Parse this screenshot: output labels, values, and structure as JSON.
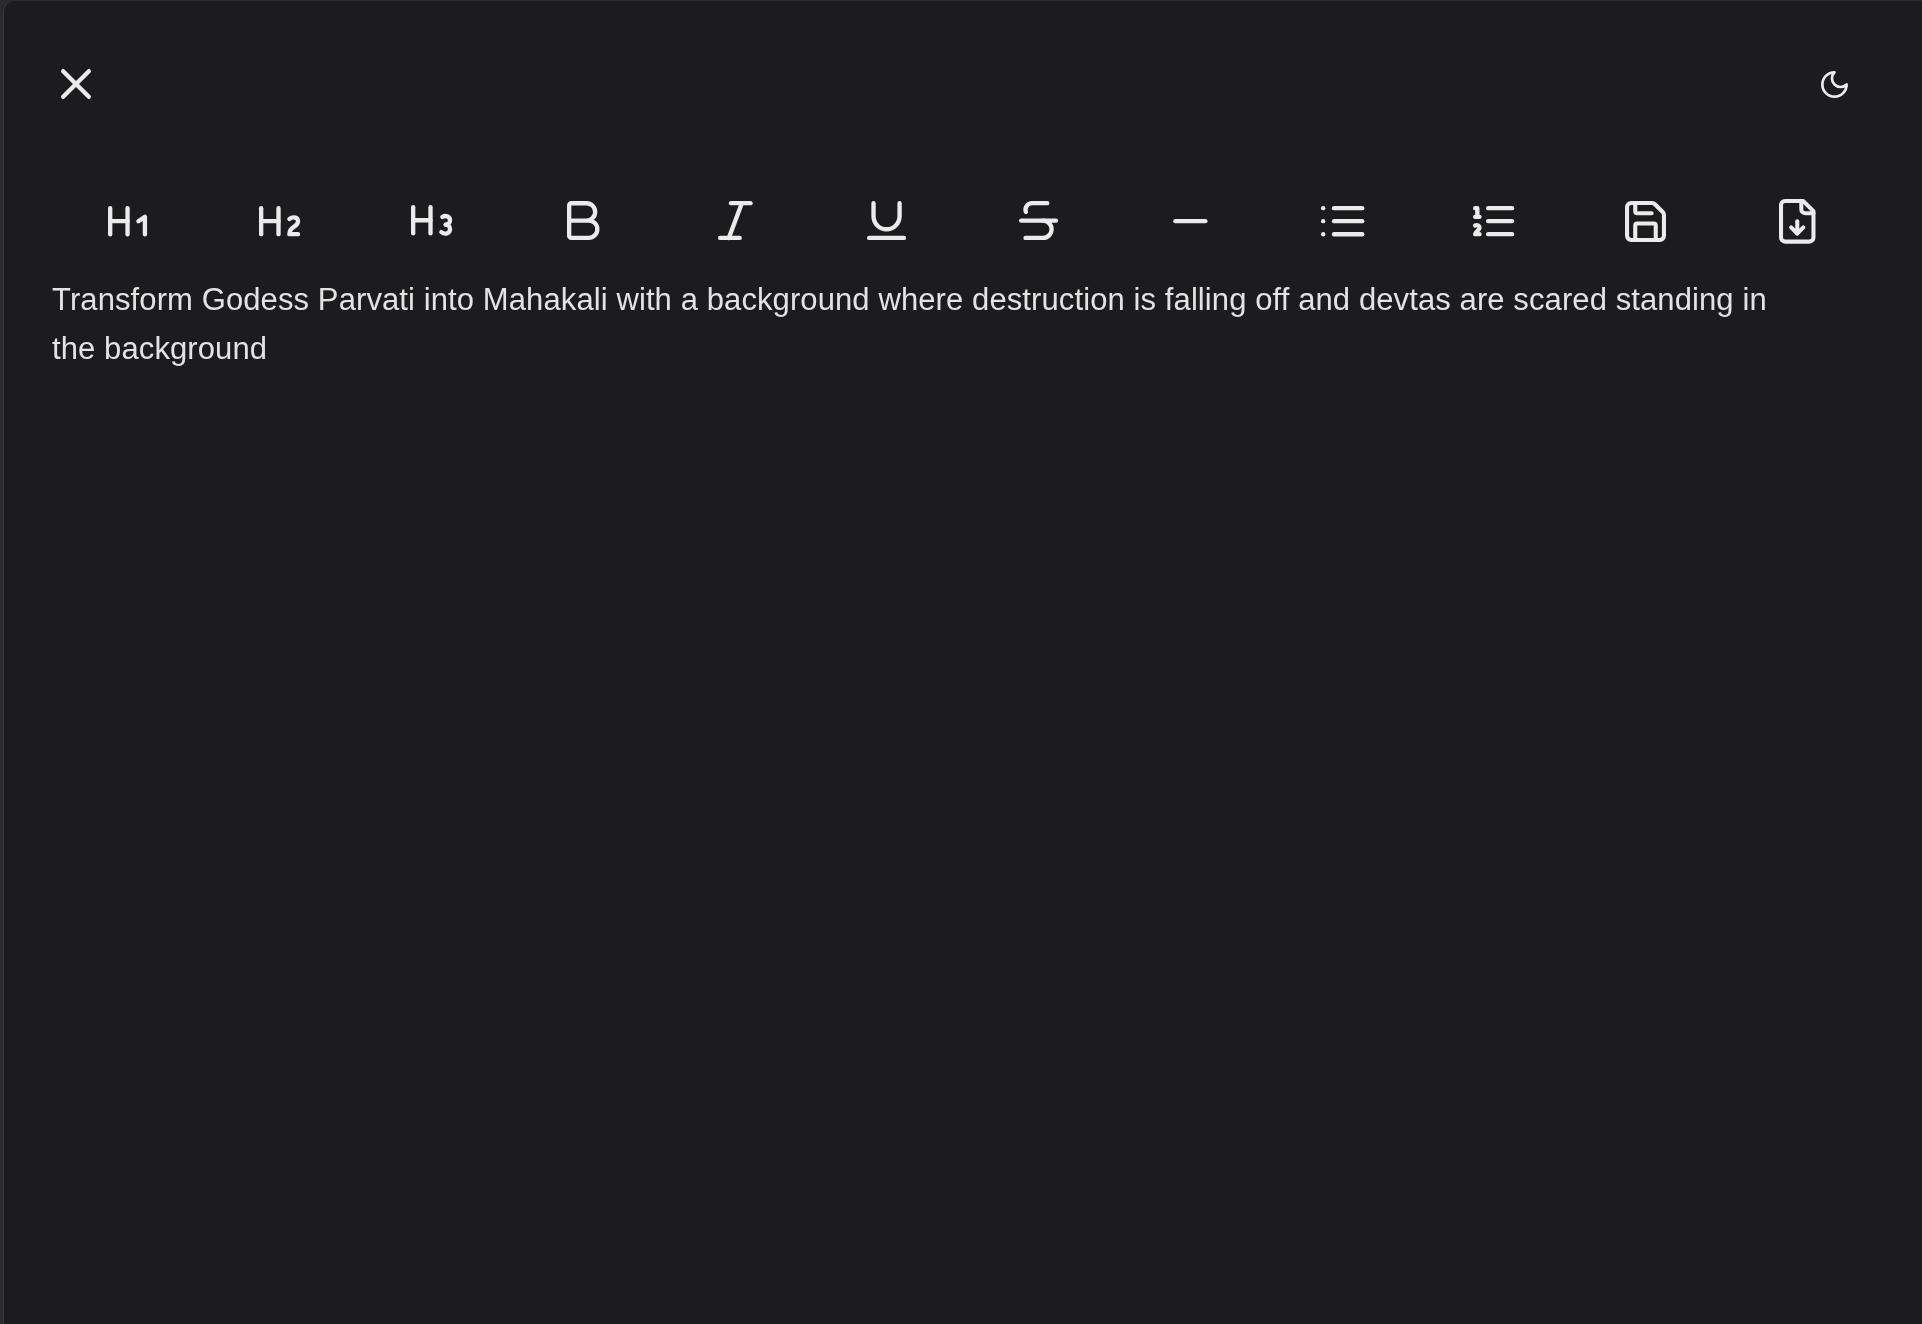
{
  "top_bar": [
    {
      "kind": "close"
    },
    {
      "kind": "theme"
    }
  ],
  "toolbar": [
    {
      "kind": "h1"
    },
    {
      "kind": "h2"
    },
    {
      "kind": "h3"
    },
    {
      "kind": "bold"
    },
    {
      "kind": "italic"
    },
    {
      "kind": "underline"
    },
    {
      "kind": "strikethrough"
    },
    {
      "kind": "rule"
    },
    {
      "kind": "bullets"
    },
    {
      "kind": "numbers"
    },
    {
      "kind": "save"
    },
    {
      "kind": "download"
    }
  ],
  "editor": {
    "text": "Transform Godess Parvati into Mahakali with a background where destruction is falling off and devtas are scared standing in the background"
  }
}
